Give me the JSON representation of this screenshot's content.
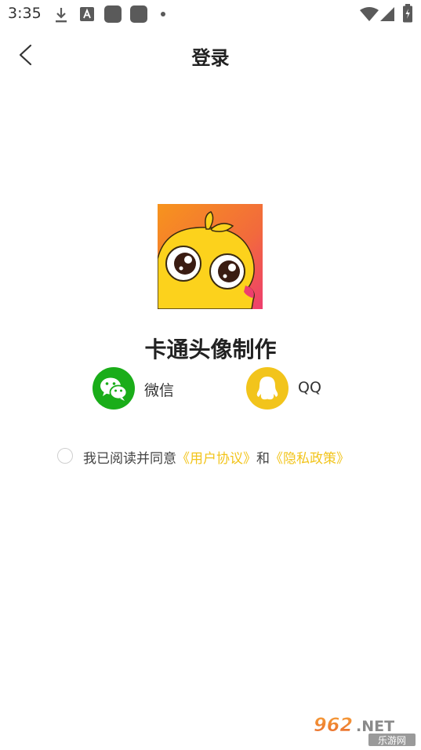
{
  "status_bar": {
    "time": "3:35",
    "icons": [
      "download-icon",
      "font-a-icon",
      "app-square-icon",
      "app-square-icon",
      "dot-icon",
      "wifi-icon",
      "signal-icon",
      "battery-icon"
    ]
  },
  "header": {
    "title": "登录",
    "back_icon": "chevron-left-icon"
  },
  "app": {
    "name": "卡通头像制作",
    "logo_icon": "cartoon-chick-logo"
  },
  "login_options": [
    {
      "label": "微信",
      "icon": "wechat-icon",
      "color": "#1aad19"
    },
    {
      "label": "QQ",
      "icon": "qq-penguin-icon",
      "color": "#f2c41b"
    }
  ],
  "agreement": {
    "prefix": "我已阅读并同意",
    "user_agreement": "《用户协议》",
    "conjunction": "和",
    "privacy_policy": "《隐私政策》",
    "link_color": "#f2c41b",
    "checked": false
  },
  "watermark": {
    "brand": "962.NET",
    "subtitle": "乐游网"
  }
}
